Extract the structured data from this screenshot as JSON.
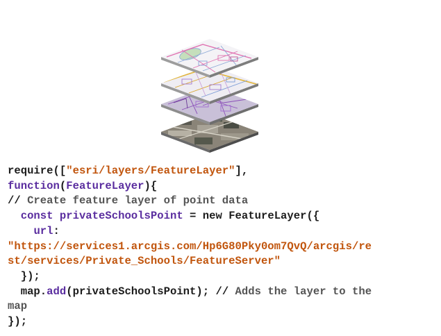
{
  "graphic": {
    "layer_names": [
      "street-map-layer",
      "parcel-layer",
      "boundary-layer",
      "imagery-layer"
    ]
  },
  "code": {
    "l1_fn": "require",
    "l1_open": "([",
    "l1_str": "\"esri/layers/FeatureLayer\"",
    "l1_close": "],",
    "l2_kw": "function",
    "l2_open": "(",
    "l2_param": "FeatureLayer",
    "l2_close": "){",
    "l3_slashes": "//",
    "l3_text": " Create feature layer of point data",
    "l4_indent": "  ",
    "l4_kw": "const",
    "l4_sp": " ",
    "l4_var": "privateSchoolsPoint",
    "l4_rest": " = new FeatureLayer({",
    "l5_indent": "    ",
    "l5_key": "url",
    "l5_colon": ":",
    "l6_str": "\"https://services1.arcgis.com/Hp6G80Pky0om7QvQ/arcgis/re",
    "l7_str": "st/services/Private_Schools/FeatureServer\"",
    "l8_text": "  });",
    "l9_indent": "  ",
    "l9_obj": "map.",
    "l9_fn": "add",
    "l9_args": "(privateSchoolsPoint); ",
    "l9_slashes": "//",
    "l9_comment": " Adds the layer to the",
    "l10_comment": "map",
    "l11_text": "});"
  }
}
